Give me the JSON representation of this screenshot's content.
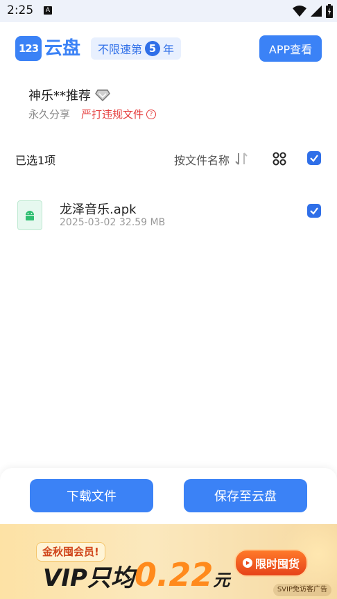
{
  "status_bar": {
    "time": "2:25",
    "notif_icon_letter": "A"
  },
  "header": {
    "logo_mark": "123",
    "logo_text": "云盘",
    "promo_prefix": "不限速第",
    "promo_number": "5",
    "promo_suffix": "年",
    "app_button": "APP查看"
  },
  "share": {
    "title": "神乐**推荐",
    "permanence": "永久分享",
    "warning": "严打违规文件",
    "help_glyph": "?"
  },
  "toolbar": {
    "selected_count": "已选1项",
    "sort_label": "按文件名称"
  },
  "files": [
    {
      "name": "龙泽音乐.apk",
      "date": "2025-03-02",
      "size": "32.59 MB",
      "checked": true
    }
  ],
  "actions": {
    "download": "下载文件",
    "save": "保存至云盘"
  },
  "ad": {
    "tag": "金秋囤会员!",
    "headline_prefix": "VIP只均",
    "price": "0.22",
    "unit": "元",
    "cta": "限时囤货",
    "footer": "SVIP免访客广告"
  },
  "colors": {
    "accent": "#3b82f6",
    "warning": "#e53e3e",
    "ad_price": "#ff8a1c"
  }
}
